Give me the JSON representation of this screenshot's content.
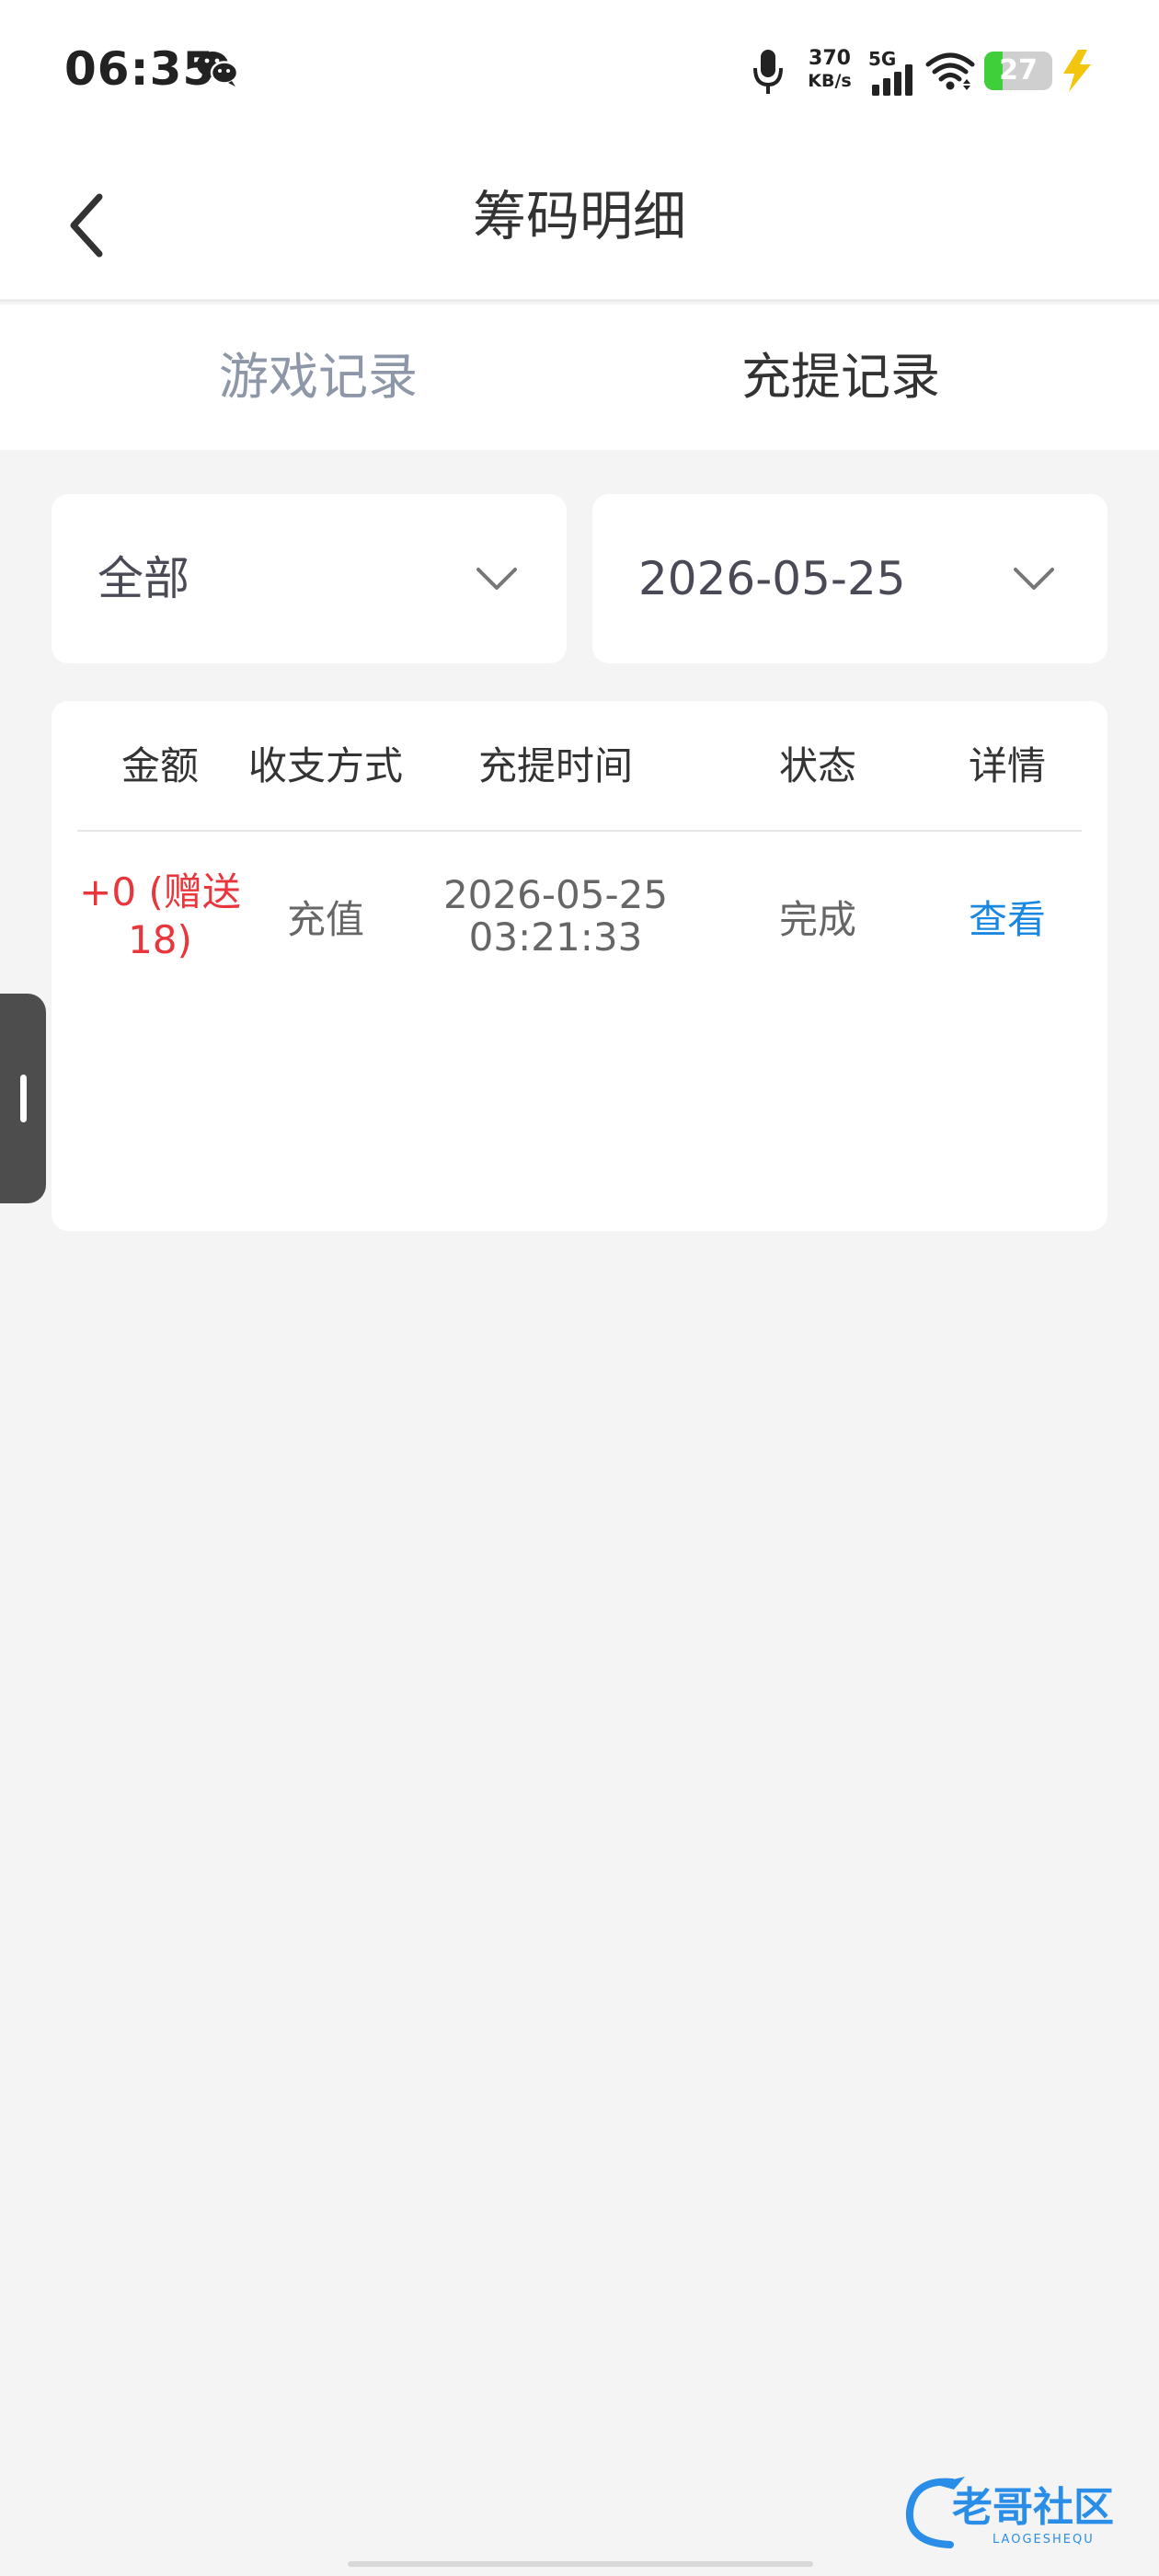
{
  "status_bar": {
    "time": "06:35",
    "net_speed_value": "370",
    "net_speed_unit": "KB/s",
    "signal_label": "5G",
    "battery_level": "27",
    "battery_fraction": 0.27,
    "icons": [
      "wechat-icon",
      "mic-icon",
      "signal-icon",
      "wifi-icon",
      "battery-icon",
      "charging-icon"
    ]
  },
  "header": {
    "title": "筹码明细",
    "back_icon": "chevron-left-icon"
  },
  "tabs": [
    {
      "label": "游戏记录",
      "active": false
    },
    {
      "label": "充提记录",
      "active": true
    }
  ],
  "filters": {
    "type": "全部",
    "date": "2026-05-25"
  },
  "table": {
    "columns": [
      "金额",
      "收支方式",
      "充提时间",
      "状态",
      "详情"
    ],
    "rows": [
      {
        "amount": "+0 (赠送18)",
        "method": "充值",
        "date": "2026-05-25",
        "time": "03:21:33",
        "status": "完成",
        "detail": "查看"
      }
    ]
  },
  "watermark": {
    "title": "老哥社区",
    "subtitle": "LAOGESHEQU"
  },
  "colors": {
    "accent_link": "#1a87e0",
    "amount_red": "#e8363c",
    "inactive_tab": "#8e97a8",
    "background": "#f4f4f4"
  }
}
